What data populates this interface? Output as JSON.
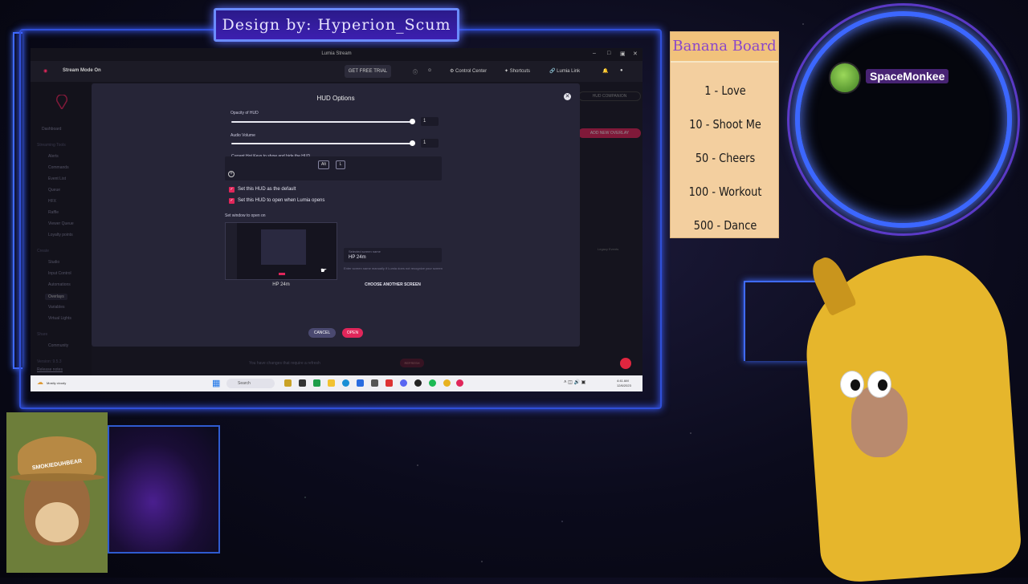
{
  "overlay": {
    "banner_text": "Design by: Hyperion_Scum",
    "username": "SpaceMonkee",
    "bear_hat_text": "SMOKIEDUHBEAR"
  },
  "board": {
    "title": "Banana Board",
    "items": [
      "1 - Love",
      "10 - Shoot Me",
      "50 - Cheers",
      "100 - Workout",
      "500 - Dance"
    ]
  },
  "app": {
    "window_title": "Lumia Stream",
    "stream_mode": "Stream Mode On",
    "trial_button": "GET FREE TRIAL",
    "control_center": "Control Center",
    "shortcuts": "Shortcuts",
    "lumia_link": "Lumia Link",
    "hud_companion": "HUD COMPANION",
    "add_overlay": "ADD NEW OVERLAY",
    "legacy": "Legacy Events",
    "version": "Version: 9.5.3",
    "release_notes": "Release notes",
    "pending_text": "You have changes that require a refresh",
    "refresh_button": "REFRESH"
  },
  "sidebar": {
    "dashboard": "Dashboard",
    "group_streaming": "Streaming Tools",
    "items_streaming": [
      "Alerts",
      "Commands",
      "Event List",
      "Queue",
      "HFX",
      "Raffle",
      "Viewer Queue",
      "Loyalty points"
    ],
    "group_create": "Create",
    "items_create": [
      "Studio",
      "Input Control",
      "Automations",
      "Overlays",
      "Variables",
      "Virtual Lights"
    ],
    "group_share": "Share",
    "community": "Community",
    "active": "Overlays"
  },
  "modal": {
    "title": "HUD Options",
    "opacity_label": "Opacity of HUD",
    "opacity_value": "1",
    "volume_label": "Audio Volume",
    "volume_value": "1",
    "hotkeys_label": "Current Hot Keys to show and hide the HUD",
    "hotkeys": [
      "Alt",
      "L"
    ],
    "default_check": "Set this HUD as the default",
    "open_check": "Set this HUD to open when Lumia opens",
    "window_label": "Set window to open on",
    "screen_name": "HP 24m",
    "selected_label": "Selected screen name",
    "selected_value": "HP 24m",
    "hint": "Enter screen name manually if Lumia does not recognize your screen",
    "choose_button": "CHOOSE ANOTHER SCREEN",
    "cancel": "CANCEL",
    "open": "OPEN"
  },
  "taskbar": {
    "search_placeholder": "Search",
    "weather": "Mostly cloudy",
    "time": "4:41 AM",
    "date": "12/6/2023"
  },
  "colors": {
    "accent": "#e0265a",
    "neon_blue": "#3a5cff",
    "board_title": "#8a47c9"
  }
}
